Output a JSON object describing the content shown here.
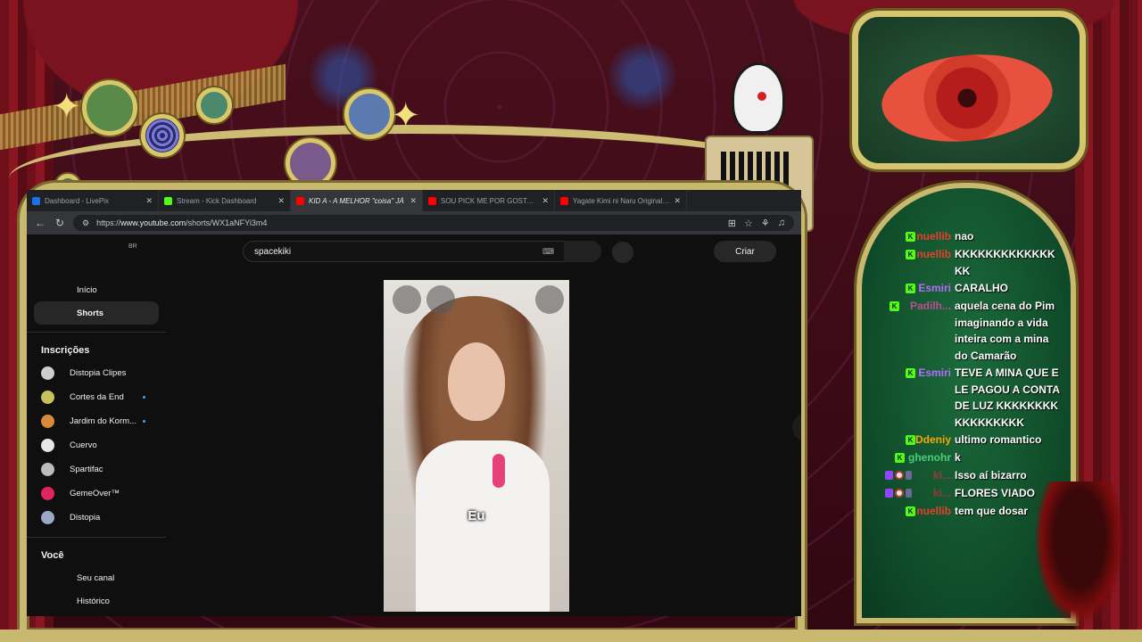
{
  "browser": {
    "tabs": [
      {
        "title": "Dashboard - LivePix",
        "favicon_color": "#1a73e8",
        "active": false
      },
      {
        "title": "Stream - Kick Dashboard",
        "favicon_color": "#53fc18",
        "active": false
      },
      {
        "title": "KID A - A MELHOR \"coisa\" JÁ",
        "favicon_color": "#ff0000",
        "active": true
      },
      {
        "title": "SOU PICK ME POR GOSTAR DE",
        "favicon_color": "#ff0000",
        "active": false
      },
      {
        "title": "Yagate Kimi ni Naru Original So",
        "favicon_color": "#ff0000",
        "active": false
      }
    ],
    "tab_close": "✕",
    "url_prefix": "https://",
    "url_host": "www.youtube.com",
    "url_path": "/shorts/WX1aNFYi3m4"
  },
  "youtube": {
    "region": "BR",
    "search_value": "spacekiki",
    "keyboard_glyph": "⌨",
    "create_label": "Criar",
    "nav": [
      {
        "label": "Início",
        "active": false
      },
      {
        "label": "Shorts",
        "active": true
      }
    ],
    "subscriptions_heading": "Inscrições",
    "subscriptions": [
      {
        "label": "Distopia Clipes",
        "avatar": "#cfcfcf",
        "live": false
      },
      {
        "label": "Cortes da End",
        "avatar": "#c9c25a",
        "live": true
      },
      {
        "label": "Jardim do Korm...",
        "avatar": "#d88a3a",
        "live": true
      },
      {
        "label": "Cuervo",
        "avatar": "#e6e6e6",
        "live": false
      },
      {
        "label": "Spartifac",
        "avatar": "#bbbbbb",
        "live": false
      },
      {
        "label": "GemeOver™",
        "avatar": "#e0245e",
        "live": false
      },
      {
        "label": "Distopia",
        "avatar": "#9aa7c7",
        "live": false
      }
    ],
    "you_heading": "Você",
    "you_items": [
      {
        "label": "Seu canal"
      },
      {
        "label": "Histórico"
      }
    ],
    "short_caption": "Eu"
  },
  "chat": {
    "messages": [
      {
        "user": "nuellib",
        "user_color": "#e8402c",
        "badge": "kick",
        "text": "nao"
      },
      {
        "user": "nuellib",
        "user_color": "#e8402c",
        "badge": "kick",
        "text": "KKKKKKKKKKKKKKK"
      },
      {
        "user": "Esmiri",
        "user_color": "#b36bff",
        "badge": "kick",
        "text": "CARALHO"
      },
      {
        "user": "Padilh...",
        "user_color": "#c04a9a",
        "badge": "kick",
        "text": "aquela cena do Pim imaginando a vida inteira com a mina do Camarão"
      },
      {
        "user": "Esmiri",
        "user_color": "#b36bff",
        "badge": "kick",
        "text": "TEVE A MINA QUE ELE PAGOU A CONTA DE LUZ KKKKKKKKKKKKKKKKK"
      },
      {
        "user": "Ddeniy",
        "user_color": "#f2a900",
        "badge": "kick",
        "text": "ultimo romantico"
      },
      {
        "user": "ghenohr",
        "user_color": "#4ad07a",
        "badge": "kick",
        "text": "k"
      },
      {
        "user": "ki...",
        "user_color": "#9a3a3a",
        "badge": "twitch",
        "text": "Isso aí bizarro"
      },
      {
        "user": "ki...",
        "user_color": "#9a3a3a",
        "badge": "twitch",
        "text": "FLORES VIADO"
      },
      {
        "user": "nuellib",
        "user_color": "#e8402c",
        "badge": "kick",
        "text": "tem que dosar"
      }
    ],
    "kick_badge_glyph": "K"
  }
}
